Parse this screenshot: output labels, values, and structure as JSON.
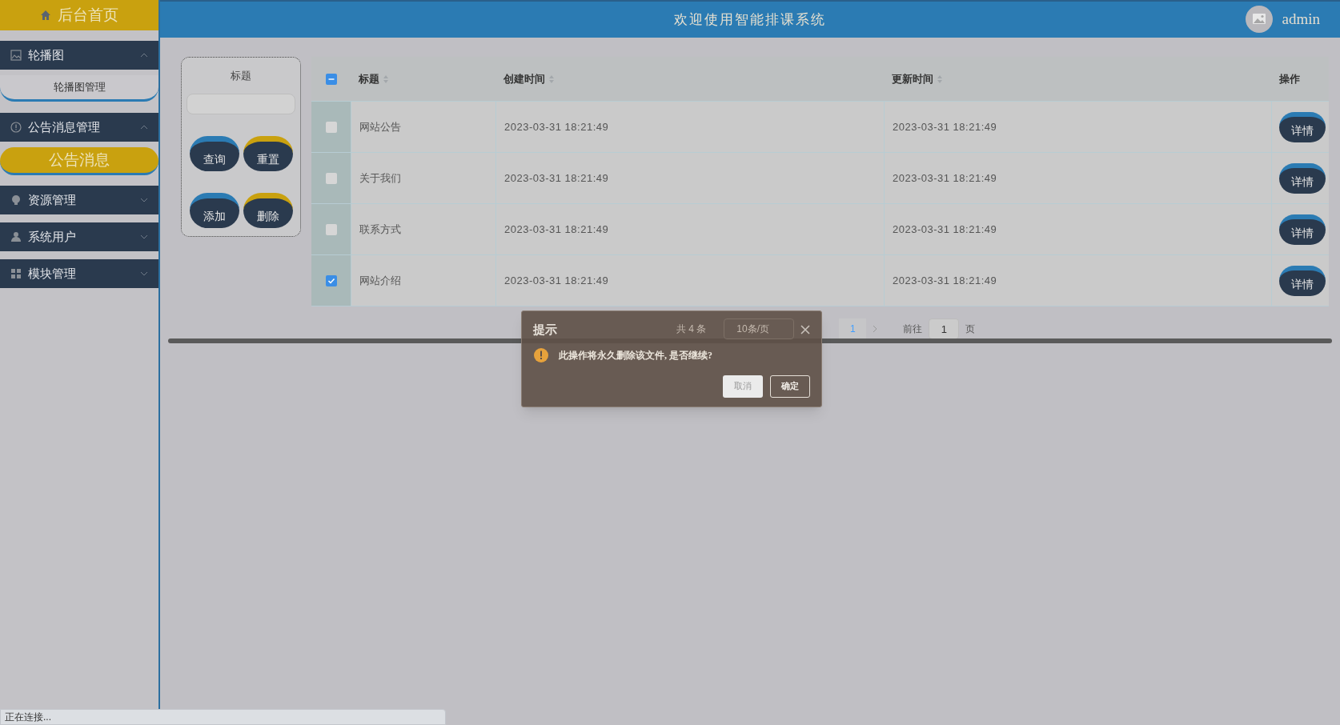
{
  "sidebar": {
    "home": "后台首页",
    "menus": [
      {
        "label": "轮播图",
        "kind": "image",
        "expanded": true,
        "children": [
          {
            "label": "轮播图管理",
            "selected": false
          }
        ]
      },
      {
        "label": "公告消息管理",
        "kind": "info",
        "expanded": true,
        "children": [
          {
            "label": "公告消息",
            "selected": true
          }
        ]
      },
      {
        "label": "资源管理",
        "kind": "bulb",
        "expanded": false
      },
      {
        "label": "系统用户",
        "kind": "user",
        "expanded": false
      },
      {
        "label": "模块管理",
        "kind": "grid",
        "expanded": false
      }
    ]
  },
  "header": {
    "title": "欢迎使用智能排课系统",
    "user": "admin"
  },
  "search": {
    "label": "标题",
    "buttons": [
      {
        "label": "查询",
        "color": "#2b7bb3"
      },
      {
        "label": "重置",
        "color": "#c9a10f"
      },
      {
        "label": "添加",
        "color": "#2b7bb3"
      },
      {
        "label": "删除",
        "color": "#c9a10f"
      }
    ]
  },
  "table": {
    "select_all": {
      "indeterminate": true
    },
    "columns": [
      {
        "label": "标题",
        "sortable": true
      },
      {
        "label": "创建时间",
        "sortable": true
      },
      {
        "label": "更新时间",
        "sortable": true
      },
      {
        "label": "操作",
        "sortable": false
      }
    ],
    "rows": [
      {
        "selected": false,
        "cells": [
          "网站公告",
          "2023-03-31 18:21:49",
          "2023-03-31 18:21:49"
        ],
        "action": "详情"
      },
      {
        "selected": false,
        "cells": [
          "关于我们",
          "2023-03-31 18:21:49",
          "2023-03-31 18:21:49"
        ],
        "action": "详情"
      },
      {
        "selected": false,
        "cells": [
          "联系方式",
          "2023-03-31 18:21:49",
          "2023-03-31 18:21:49"
        ],
        "action": "详情"
      },
      {
        "selected": true,
        "cells": [
          "网站介绍",
          "2023-03-31 18:21:49",
          "2023-03-31 18:21:49"
        ],
        "action": "详情"
      }
    ]
  },
  "pagination": {
    "total": "共 4 条",
    "page_size": "10条/页",
    "pages": [
      {
        "label": "1",
        "selected": true
      }
    ],
    "goto_label": "前往",
    "goto_value": "1",
    "goto_suffix": "页"
  },
  "dialog": {
    "title": "提示",
    "message": "此操作将永久删除该文件, 是否继续?",
    "buttons": [
      {
        "label": "取消",
        "primary": false
      },
      {
        "label": "确定",
        "primary": true
      }
    ]
  },
  "status_bar": "正在连接..."
}
